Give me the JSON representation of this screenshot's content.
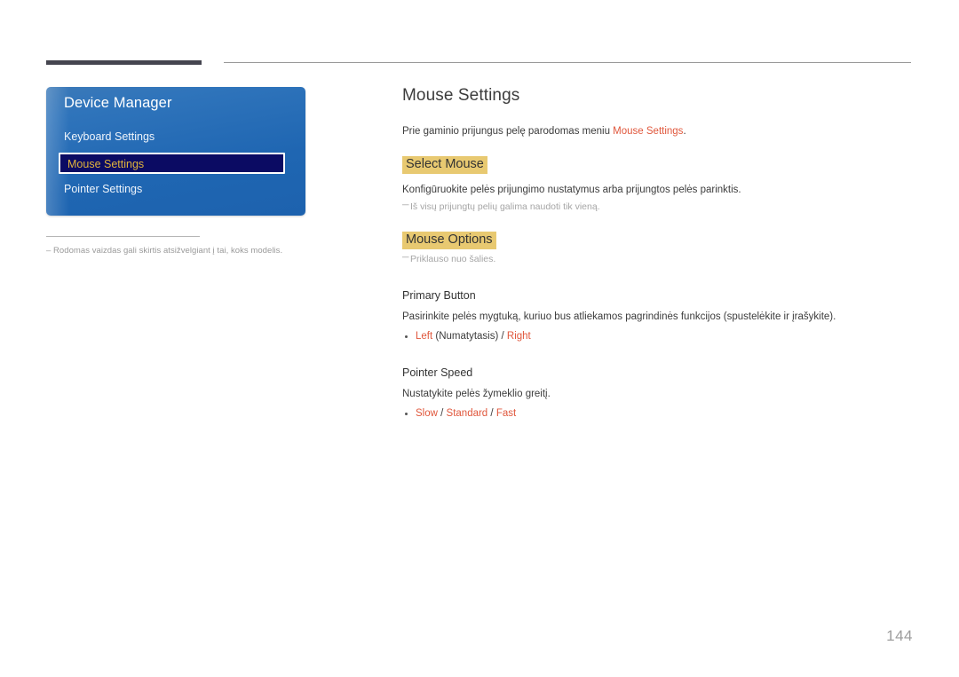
{
  "page": {
    "number": "144",
    "background_color": "#ffffff"
  },
  "header": {
    "bar_color": "#45454f",
    "line_color": "#999999"
  },
  "osd_menu": {
    "title": "Device Manager",
    "accent_blue": "#1f66b2",
    "selected_background": "#0b0b63",
    "selected_text_color": "#e0b33c",
    "items": [
      {
        "label": "Keyboard Settings",
        "selected": false
      },
      {
        "label": "Mouse Settings",
        "selected": true
      },
      {
        "label": "Pointer Settings",
        "selected": false
      }
    ]
  },
  "left_note": {
    "dash": "–",
    "text": "Rodomas vaizdas gali skirtis atsižvelgiant į tai, koks modelis."
  },
  "content": {
    "title": "Mouse Settings",
    "intro_before": "Prie gaminio prijungus pelę parodomas meniu ",
    "intro_accent": "Mouse Settings",
    "intro_after": ".",
    "highlight_color": "#e8c971",
    "accent_color": "#e0573c",
    "sections": [
      {
        "heading": "Select Mouse",
        "heading_style": "highlight",
        "body": "Konfigūruokite pelės prijungimo nustatymus arba prijungtos pelės parinktis.",
        "note": "Iš visų prijungtų pelių galima naudoti tik vieną.",
        "note_dash": "─"
      },
      {
        "heading": "Mouse Options",
        "heading_style": "highlight",
        "note": "Priklauso nuo šalies.",
        "note_dash": "─"
      },
      {
        "heading": "Primary Button",
        "heading_style": "plain",
        "body": "Pasirinkite pelės mygtuką, kuriuo bus atliekamos pagrindinės funkcijos (spustelėkite ir įrašykite).",
        "options": [
          {
            "label": "Left",
            "accent": true
          },
          {
            "label": " (Numatytasis) ",
            "accent": false
          },
          {
            "label": "/ ",
            "accent": false
          },
          {
            "label": "Right",
            "accent": true
          }
        ]
      },
      {
        "heading": "Pointer Speed",
        "heading_style": "plain",
        "body": "Nustatykite pelės žymeklio greitį.",
        "options": [
          {
            "label": "Slow",
            "accent": true
          },
          {
            "label": " / ",
            "accent": false
          },
          {
            "label": "Standard",
            "accent": true
          },
          {
            "label": " / ",
            "accent": false
          },
          {
            "label": "Fast",
            "accent": true
          }
        ]
      }
    ]
  }
}
